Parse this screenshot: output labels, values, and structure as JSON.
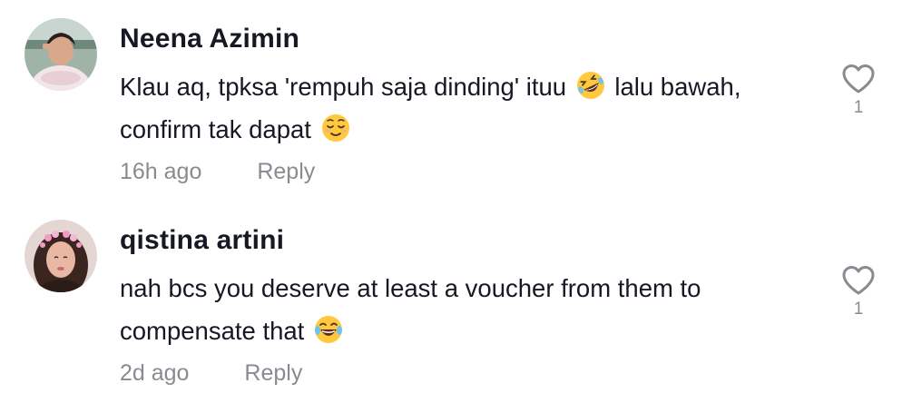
{
  "comments": [
    {
      "username": "Neena Azimin",
      "text_part1": "Klau aq, tpksa 'rempuh saja dinding' ituu ",
      "emoji1": "rolling-on-floor-laughing-emoji",
      "text_part2": " lalu bawah, confirm tak dapat ",
      "emoji2": "relieved-face-emoji",
      "time": "16h ago",
      "reply": "Reply",
      "likes": "1"
    },
    {
      "username": "qistina artini",
      "text_part1": "nah bcs you deserve at least a voucher from them to compensate that ",
      "emoji1": "face-with-tears-of-joy-emoji",
      "time": "2d ago",
      "reply": "Reply",
      "likes": "1"
    }
  ],
  "colors": {
    "text": "#161823",
    "muted": "#8a8b91",
    "emoji_yellow": "#ffc83d"
  }
}
